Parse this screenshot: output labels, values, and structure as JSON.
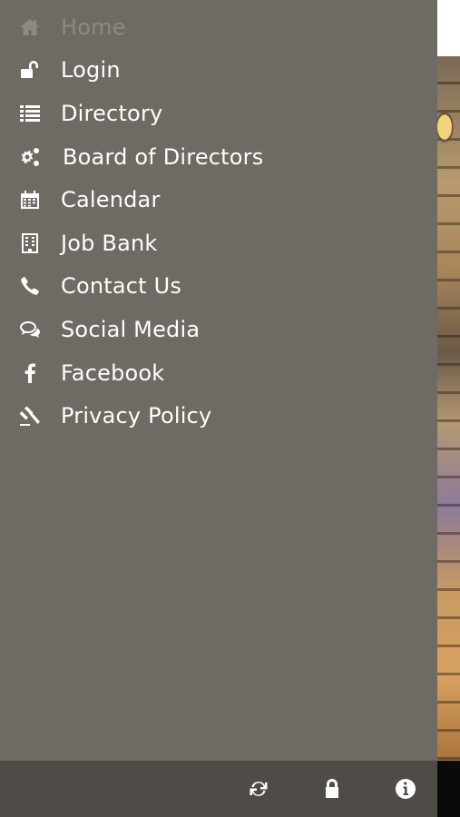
{
  "menu": {
    "items": [
      {
        "label": "Home",
        "icon": "home-icon"
      },
      {
        "label": "Login",
        "icon": "unlock-icon"
      },
      {
        "label": "Directory",
        "icon": "list-icon"
      },
      {
        "label": "Board of Directors",
        "icon": "gears-icon"
      },
      {
        "label": "Calendar",
        "icon": "calendar-icon"
      },
      {
        "label": "Job Bank",
        "icon": "building-icon"
      },
      {
        "label": "Contact Us",
        "icon": "phone-icon"
      },
      {
        "label": "Social Media",
        "icon": "chat-bubbles-icon"
      },
      {
        "label": "Facebook",
        "icon": "facebook-icon"
      },
      {
        "label": "Privacy Policy",
        "icon": "gavel-icon"
      }
    ]
  },
  "bottom_bar": {
    "buttons": [
      {
        "icon": "refresh-icon"
      },
      {
        "icon": "lock-icon"
      },
      {
        "icon": "info-icon"
      }
    ]
  },
  "colors": {
    "drawer_bg": "#6e6a64",
    "bottom_bar_bg": "#4f4c48",
    "text": "#ffffff",
    "disabled_text": "#8d8983"
  }
}
